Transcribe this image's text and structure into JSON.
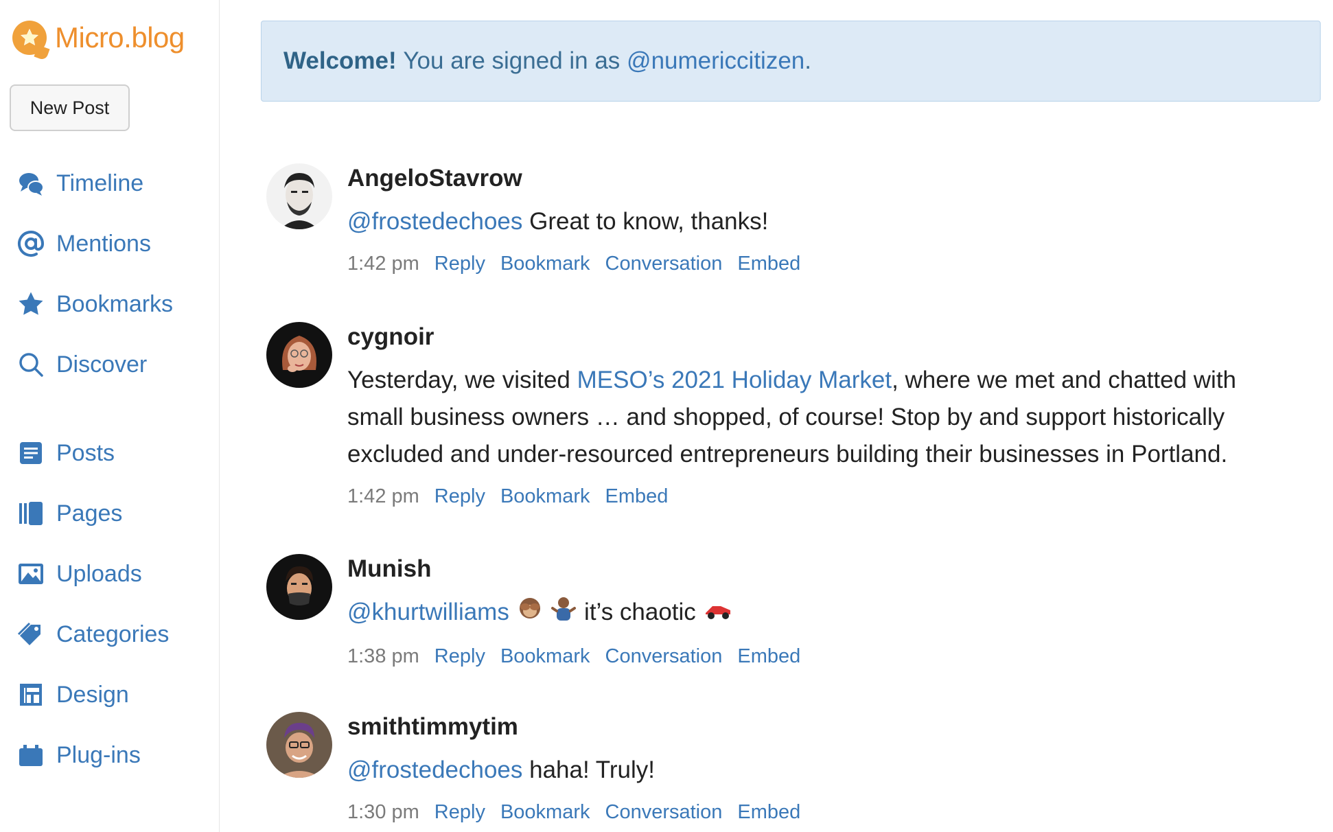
{
  "brand": {
    "name": "Micro.blog"
  },
  "sidebar": {
    "new_post_label": "New Post",
    "items": [
      {
        "label": "Timeline",
        "icon": "chat-bubbles-icon"
      },
      {
        "label": "Mentions",
        "icon": "at-icon"
      },
      {
        "label": "Bookmarks",
        "icon": "star-icon"
      },
      {
        "label": "Discover",
        "icon": "search-icon"
      },
      {
        "label": "Posts",
        "icon": "document-icon"
      },
      {
        "label": "Pages",
        "icon": "book-icon"
      },
      {
        "label": "Uploads",
        "icon": "image-icon"
      },
      {
        "label": "Categories",
        "icon": "tag-icon"
      },
      {
        "label": "Design",
        "icon": "layout-icon"
      },
      {
        "label": "Plug-ins",
        "icon": "plugin-icon"
      }
    ]
  },
  "welcome": {
    "strong": "Welcome!",
    "text": "You are signed in as",
    "handle": "@numericcitizen",
    "suffix": "."
  },
  "posts": [
    {
      "author": "AngeloStavrow",
      "mention": "@frostedechoes",
      "text": "Great to know, thanks!",
      "time": "1:42 pm",
      "actions": [
        "Reply",
        "Bookmark",
        "Conversation",
        "Embed"
      ]
    },
    {
      "author": "cygnoir",
      "text_before": "Yesterday, we visited",
      "link": "MESO’s 2021 Holiday Market",
      "text_after": ", where we met and chatted with small business owners … and shopped, of course! Stop by and support historically excluded and under-resourced entrepreneurs building their businesses in Portland.",
      "time": "1:42 pm",
      "actions": [
        "Reply",
        "Bookmark",
        "Embed"
      ]
    },
    {
      "author": "Munish",
      "mention": "@khurtwilliams",
      "text": "it’s chaotic",
      "time": "1:38 pm",
      "actions": [
        "Reply",
        "Bookmark",
        "Conversation",
        "Embed"
      ]
    },
    {
      "author": "smithtimmytim",
      "mention": "@frostedechoes",
      "text": "haha! Truly!",
      "time": "1:30 pm",
      "actions": [
        "Reply",
        "Bookmark",
        "Conversation",
        "Embed"
      ]
    }
  ],
  "colors": {
    "brand": "#ee8f2d",
    "link": "#3a78b8",
    "welcome_bg": "#ddeaf6"
  }
}
